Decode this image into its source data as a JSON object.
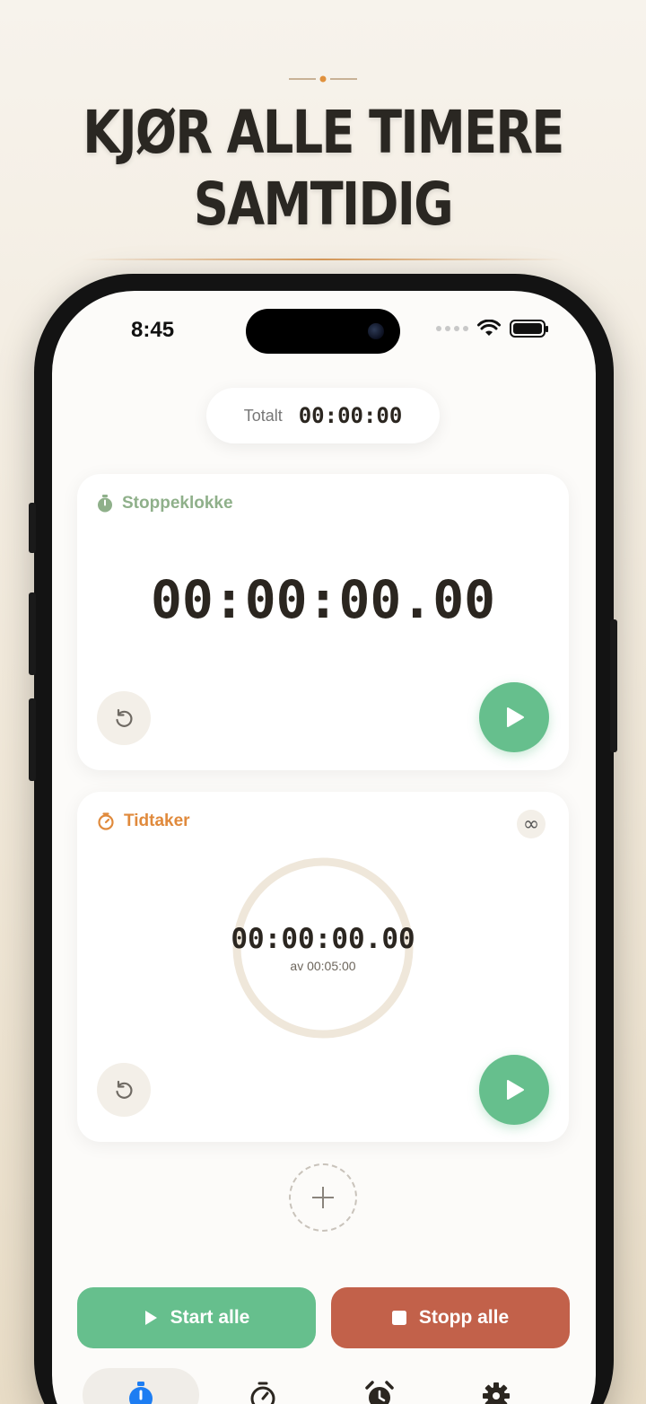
{
  "headline": {
    "line1": "KJØR ALLE TIMERE",
    "line2": "SAMTIDIG"
  },
  "status": {
    "time": "8:45"
  },
  "total": {
    "label": "Totalt",
    "value": "00:00:00"
  },
  "stopwatch": {
    "title": "Stoppeklokke",
    "time": "00:00:00.00",
    "color": "#8fb08a"
  },
  "timer": {
    "title": "Tidtaker",
    "time": "00:00:00.00",
    "of": "av 00:05:00",
    "color": "#e08a3c",
    "loop_icon": "∞"
  },
  "actions": {
    "start_all": "Start alle",
    "stop_all": "Stopp alle"
  },
  "colors": {
    "green": "#66bf8d",
    "red": "#c2614a",
    "accent_blue": "#1d7df2"
  },
  "tabs": [
    {
      "icon": "stopwatch-icon",
      "active": true
    },
    {
      "icon": "timer-icon",
      "active": false
    },
    {
      "icon": "alarm-icon",
      "active": false
    },
    {
      "icon": "gear-icon",
      "active": false
    }
  ]
}
